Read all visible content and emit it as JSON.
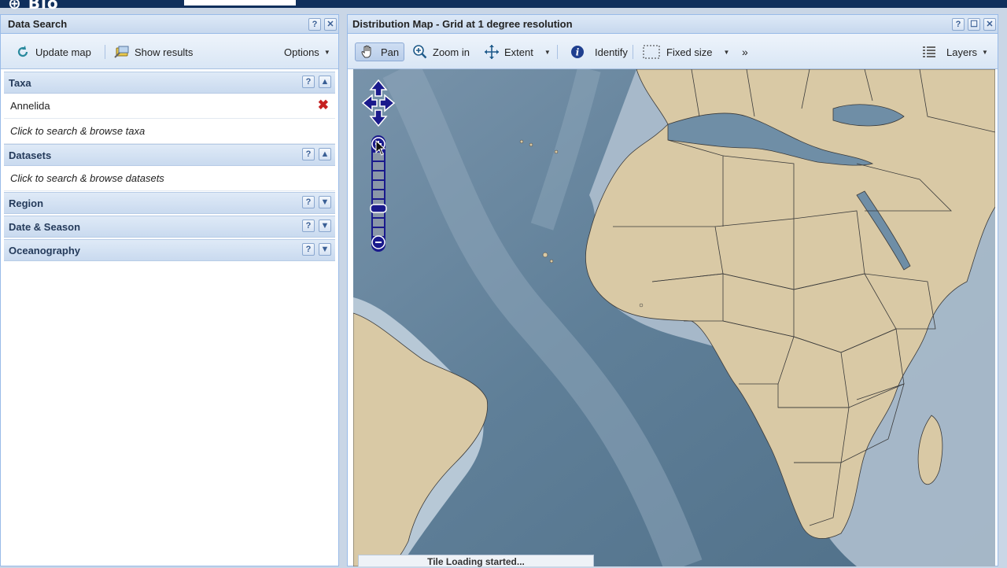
{
  "left_panel": {
    "title": "Data Search",
    "toolbar": {
      "update_map": "Update map",
      "show_results": "Show results",
      "options": "Options"
    },
    "sections": {
      "taxa": {
        "title": "Taxa",
        "item": "Annelida",
        "browse": "Click to search & browse taxa"
      },
      "datasets": {
        "title": "Datasets",
        "browse": "Click to search & browse datasets"
      },
      "region": {
        "title": "Region"
      },
      "date_season": {
        "title": "Date & Season"
      },
      "oceanography": {
        "title": "Oceanography"
      }
    }
  },
  "map_panel": {
    "title": "Distribution Map - Grid at 1 degree resolution",
    "toolbar": {
      "pan": "Pan",
      "zoom_in": "Zoom in",
      "extent": "Extent",
      "identify": "Identify",
      "fixed_size": "Fixed size",
      "more": "»",
      "layers": "Layers"
    },
    "status": "Tile Loading started..."
  },
  "colors": {
    "ocean": "#5e8099",
    "land": "#d9c9a5",
    "accent": "#0f2f5c",
    "nav_control": "#1a1a8c"
  }
}
